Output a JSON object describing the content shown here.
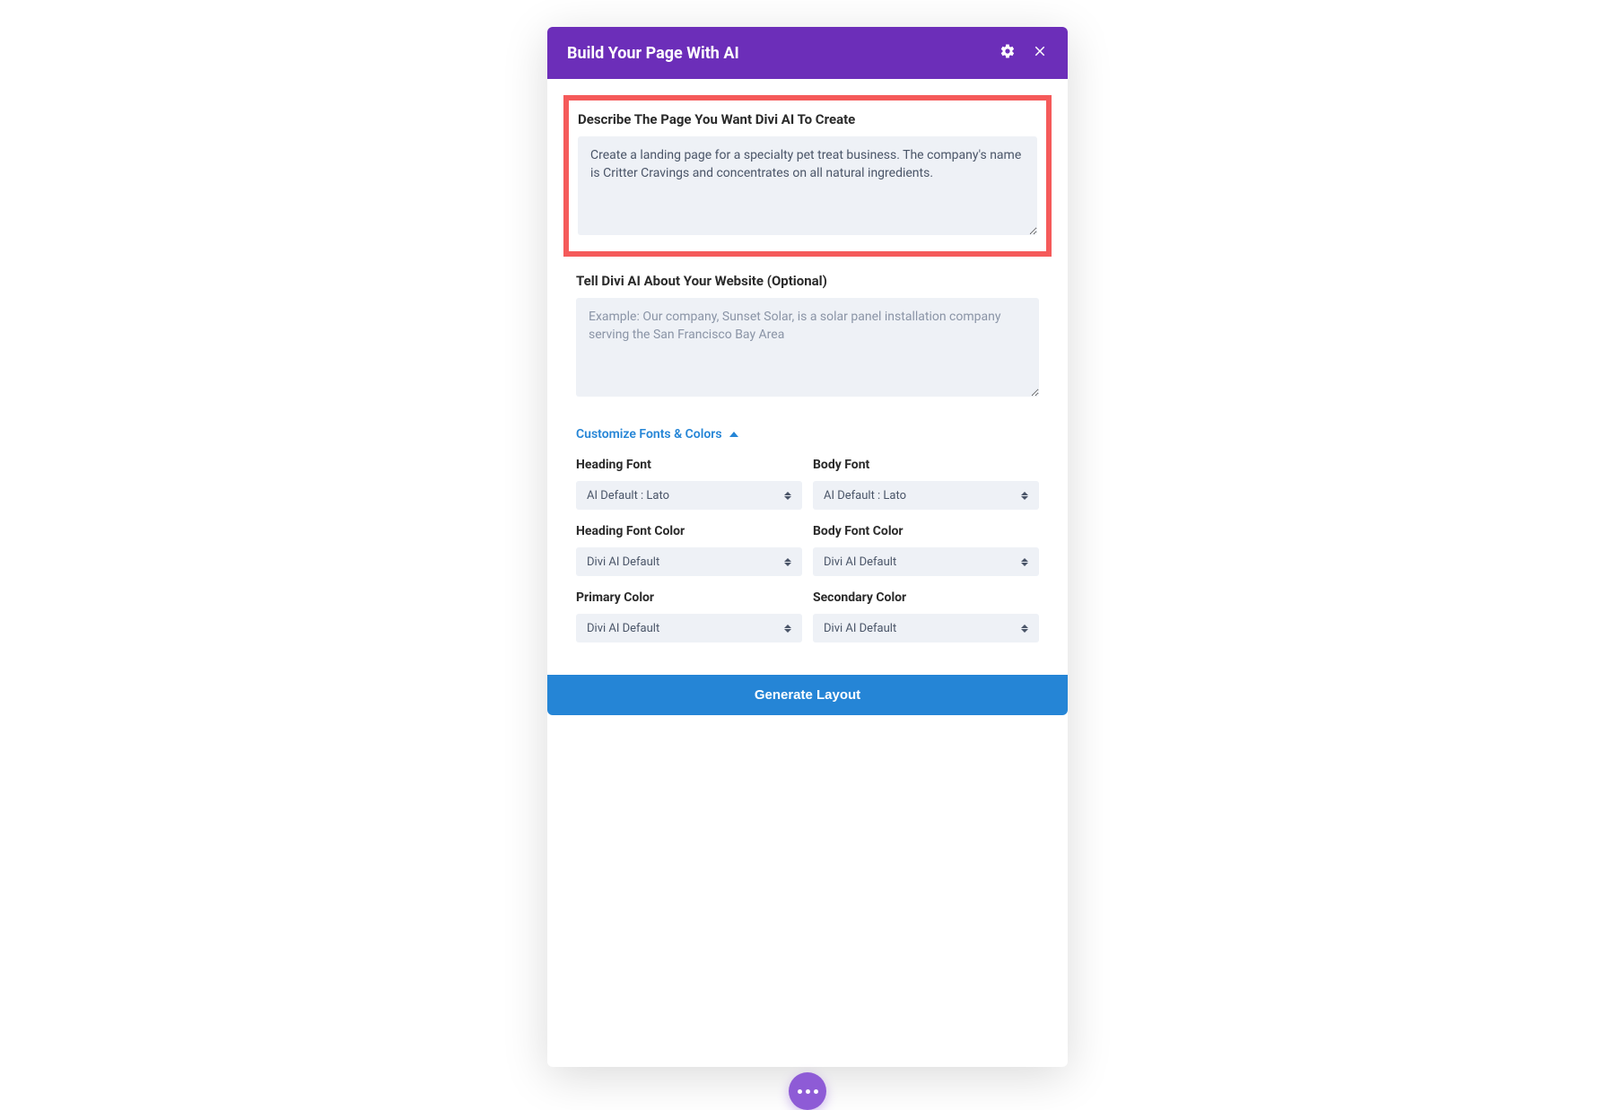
{
  "header": {
    "title": "Build Your Page With AI"
  },
  "describe": {
    "label": "Describe The Page You Want Divi AI To Create",
    "value": "Create a landing page for a specialty pet treat business. The company's name is Critter Cravings and concentrates on all natural ingredients."
  },
  "website_info": {
    "label": "Tell Divi AI About Your Website (Optional)",
    "placeholder": "Example: Our company, Sunset Solar, is a solar panel installation company serving the San Francisco Bay Area"
  },
  "customize_toggle": "Customize Fonts & Colors",
  "fields": {
    "heading_font": {
      "label": "Heading Font",
      "value": "AI Default : Lato"
    },
    "body_font": {
      "label": "Body Font",
      "value": "AI Default : Lato"
    },
    "heading_font_color": {
      "label": "Heading Font Color",
      "value": "Divi AI Default"
    },
    "body_font_color": {
      "label": "Body Font Color",
      "value": "Divi AI Default"
    },
    "primary_color": {
      "label": "Primary Color",
      "value": "Divi AI Default"
    },
    "secondary_color": {
      "label": "Secondary Color",
      "value": "Divi AI Default"
    }
  },
  "generate_button": "Generate Layout"
}
